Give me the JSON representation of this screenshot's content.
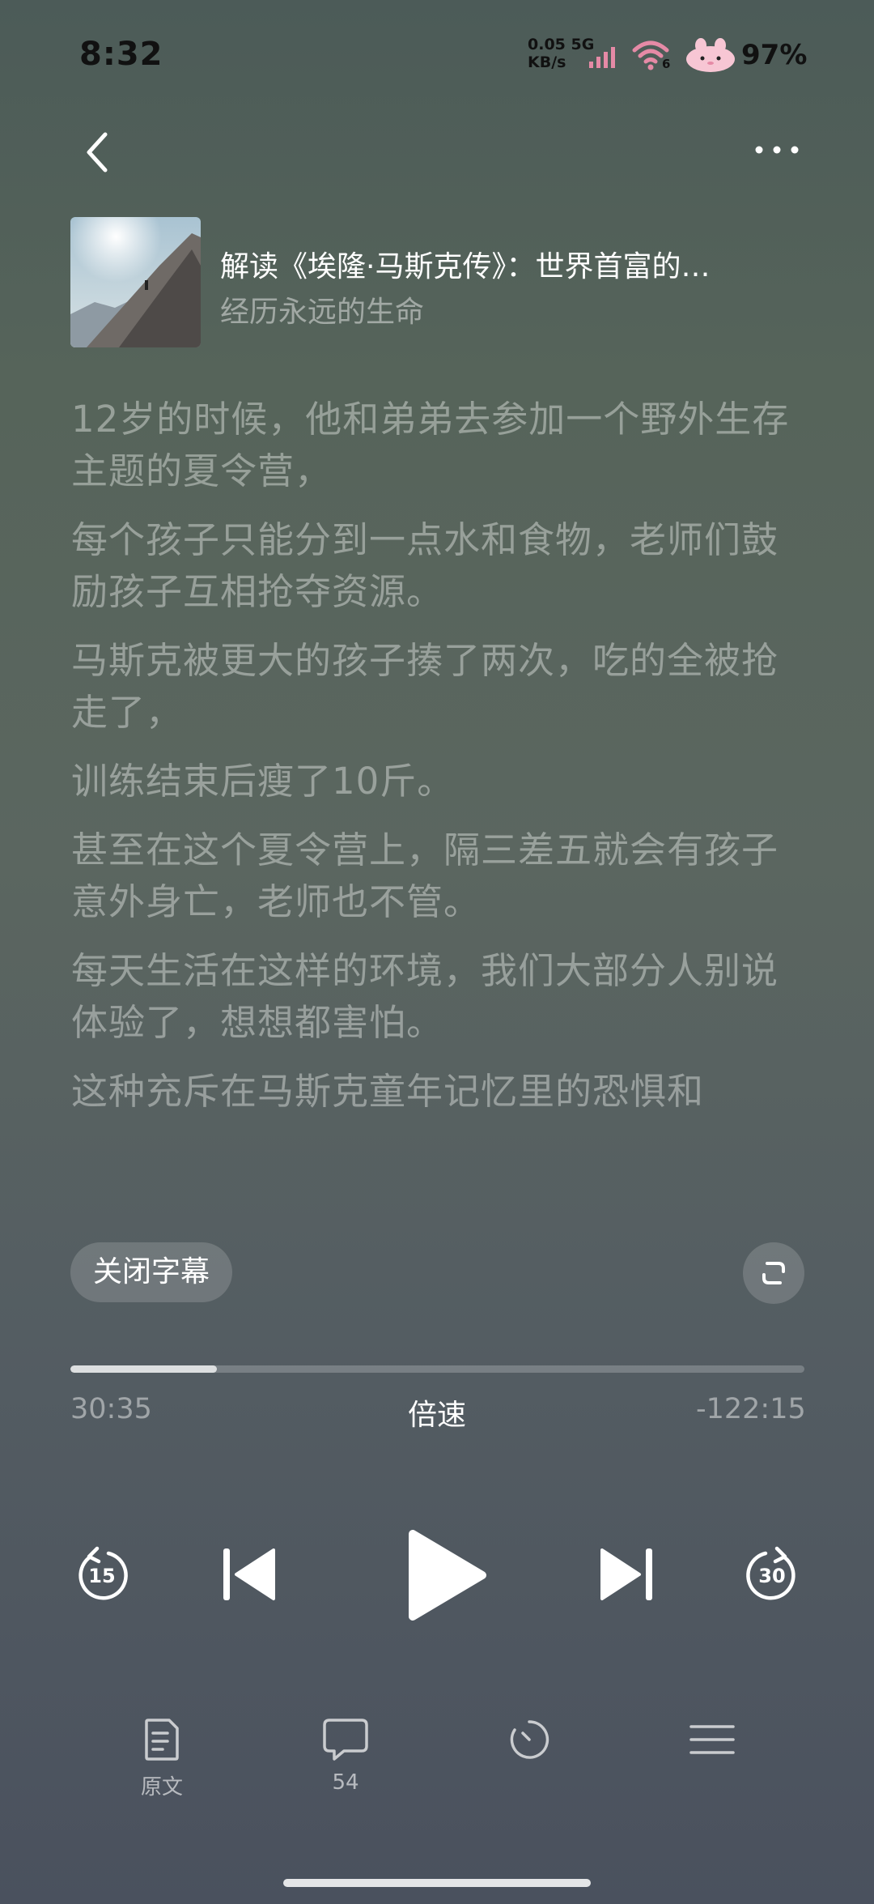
{
  "status_bar": {
    "time": "8:32",
    "net_speed_value": "0.05",
    "net_speed_unit": "KB/s",
    "network_type": "5G",
    "wifi_number": "6",
    "battery": "97%"
  },
  "book": {
    "title": "解读《埃隆·马斯克传》：世界首富的…",
    "subtitle": "经历永远的生命"
  },
  "subtitles": [
    "12岁的时候，他和弟弟去参加一个野外生存主题的夏令营，",
    "每个孩子只能分到一点水和食物，老师们鼓励孩子互相抢夺资源。",
    "马斯克被更大的孩子揍了两次，吃的全被抢走了，",
    "训练结束后瘦了10斤。",
    "甚至在这个夏令营上，隔三差五就会有孩子意外身亡，老师也不管。",
    "每天生活在这样的环境，我们大部分人别说体验了，想想都害怕。",
    "这种充斥在马斯克童年记忆里的恐惧和"
  ],
  "subtitle_toggle_label": "关闭字幕",
  "player": {
    "elapsed": "30:35",
    "speed_label": "倍速",
    "remaining": "-122:15",
    "progress_fraction": 0.2,
    "rewind_seconds": "15",
    "forward_seconds": "30"
  },
  "bottom_nav": {
    "original_label": "原文",
    "comments_count": "54"
  },
  "icons": {
    "back": "chevron-left-icon",
    "more": "more-dots-icon",
    "expand": "expand-icon",
    "rewind": "rewind-15-icon",
    "prev": "skip-previous-icon",
    "play": "play-icon",
    "next": "skip-next-icon",
    "forward": "forward-30-icon",
    "original": "document-icon",
    "comments": "comment-bubble-icon",
    "timer": "timer-icon",
    "playlist": "menu-icon"
  }
}
